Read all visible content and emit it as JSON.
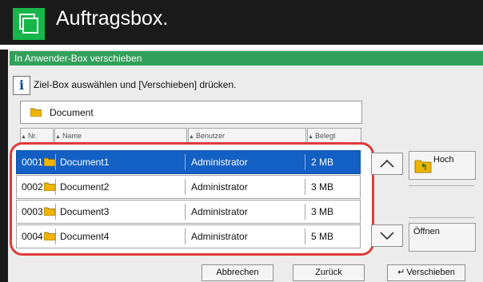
{
  "app": {
    "title": "Auftragsbox.",
    "icon": "document-box-icon"
  },
  "dialog": {
    "title": "In Anwender-Box verschieben",
    "message": "Ziel-Box auswählen und [Verschieben] drücken.",
    "info_icon": "i",
    "path": "Document"
  },
  "table": {
    "columns": [
      {
        "label": "Nr."
      },
      {
        "label": "Name"
      },
      {
        "label": "Benutzer"
      },
      {
        "label": "Belegt"
      }
    ],
    "rows": [
      {
        "nr": "0001",
        "name": "Document1",
        "user": "Administrator",
        "size": "2 MB",
        "selected": true
      },
      {
        "nr": "0002",
        "name": "Document2",
        "user": "Administrator",
        "size": "3 MB",
        "selected": false
      },
      {
        "nr": "0003",
        "name": "Document3",
        "user": "Administrator",
        "size": "3 MB",
        "selected": false
      },
      {
        "nr": "0004",
        "name": "Document4",
        "user": "Administrator",
        "size": "5 MB",
        "selected": false
      }
    ]
  },
  "side_buttons": {
    "up": "Hoch",
    "open": "Öffnen"
  },
  "footer": {
    "cancel": "Abbrechen",
    "back": "Zurück",
    "move": "Verschieben"
  },
  "colors": {
    "header_bg": "#1a1a1a",
    "accent_green": "#16b64a",
    "dialog_title_bg": "#32a05a",
    "selection_blue": "#1260c4",
    "highlight_red": "#e23a3a",
    "folder_yellow": "#f0b400"
  }
}
